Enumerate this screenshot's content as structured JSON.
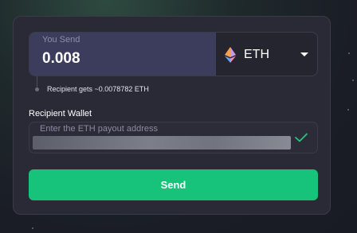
{
  "send": {
    "label": "You Send",
    "amount": "0.008",
    "currency": "ETH",
    "currency_icon": "ethereum-icon"
  },
  "estimate": {
    "text": "Recipient gets ~0.0078782 ETH"
  },
  "wallet": {
    "title": "Recipient Wallet",
    "placeholder": "Enter the ETH payout address",
    "value_redacted": true,
    "valid_icon": "check-icon"
  },
  "send_button": {
    "label": "Send"
  },
  "colors": {
    "accent": "#17c27b",
    "card_background": "#292a35",
    "amount_field": "#3c3d5c",
    "valid_check": "#2ec27e"
  }
}
